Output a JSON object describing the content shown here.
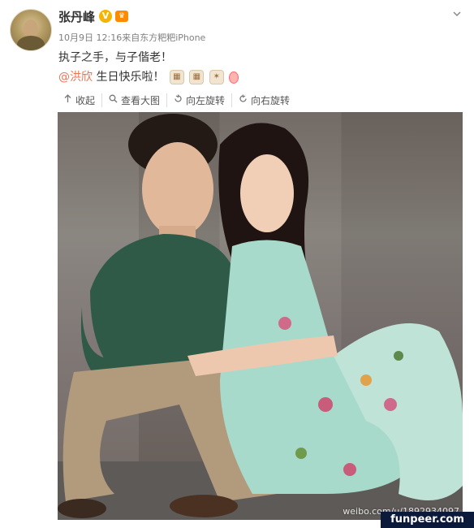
{
  "post": {
    "username": "张丹峰",
    "verified_badge": "V",
    "level_badge": "♛",
    "meta": "10月9日 12:16来自东方粑粑iPhone",
    "text_line1": "执子之手，与子偕老！",
    "mention": "@洪欣",
    "text_line2": " 生日快乐啦！",
    "emoji_icons": [
      "cake-icon",
      "cake-icon",
      "party-popper-icon",
      "balloon-icon"
    ]
  },
  "toolbar": {
    "collapse_label": "收起",
    "view_large_label": "查看大图",
    "rotate_left_label": "向左旋转",
    "rotate_right_label": "向右旋转"
  },
  "image": {
    "watermark": "weibo.com/u/1892934097"
  },
  "site_badge": "funpeer.com",
  "colors": {
    "mention": "#eb7350",
    "meta": "#808080",
    "text": "#333333"
  }
}
